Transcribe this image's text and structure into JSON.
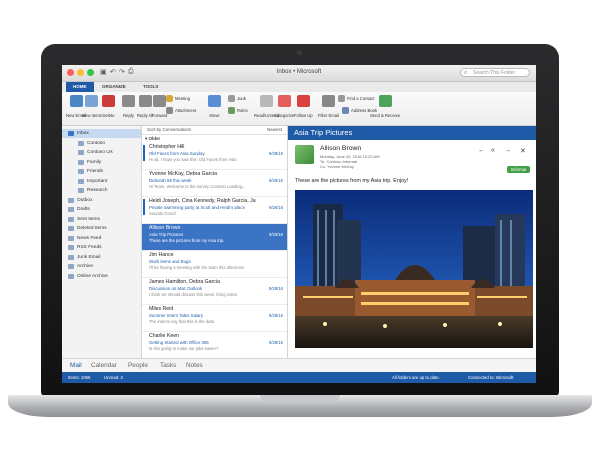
{
  "window": {
    "title": "Inbox • Microsoft",
    "search_placeholder": "Search This Folder"
  },
  "ribbon": {
    "tabs": [
      "HOME",
      "ORGANIZE",
      "TOOLS"
    ],
    "buttons": [
      {
        "label": "New Email",
        "icon": "new-email-icon",
        "color": "#4a86c7"
      },
      {
        "label": "New Items",
        "icon": "new-items-icon",
        "color": "#7aa4d6"
      },
      {
        "label": "Delete",
        "icon": "delete-icon",
        "color": "#cc3b3b"
      },
      {
        "label": "Reply",
        "icon": "reply-icon",
        "color": "#8a8a8a"
      },
      {
        "label": "Reply All",
        "icon": "reply-all-icon",
        "color": "#8a8a8a"
      },
      {
        "label": "Forward",
        "icon": "forward-icon",
        "color": "#8a8a8a"
      },
      {
        "label": "Meeting",
        "icon": "meeting-icon",
        "color": "#d9a73a"
      },
      {
        "label": "Attachment",
        "icon": "attachment-icon",
        "color": "#8a8a8a"
      },
      {
        "label": "Move",
        "icon": "move-icon",
        "color": "#5b8dd6"
      },
      {
        "label": "Junk",
        "icon": "junk-icon",
        "color": "#999999"
      },
      {
        "label": "Rules",
        "icon": "rules-icon",
        "color": "#6b9b5a"
      },
      {
        "label": "Read/Unread",
        "icon": "envelope-icon",
        "color": "#b8b8b8"
      },
      {
        "label": "Categorize",
        "icon": "categorize-icon",
        "color": "#e35d5d"
      },
      {
        "label": "Follow Up",
        "icon": "flag-icon",
        "color": "#d94040"
      },
      {
        "label": "Filter Email",
        "icon": "filter-icon",
        "color": "#888888"
      },
      {
        "label": "Find a Contact",
        "icon": "contact-icon",
        "color": "#999999"
      },
      {
        "label": "Address Book",
        "icon": "address-book-icon",
        "color": "#6a87b5"
      },
      {
        "label": "Send & Receive",
        "icon": "send-receive-icon",
        "color": "#4ca35a"
      }
    ]
  },
  "folders": [
    {
      "label": "Inbox",
      "selected": true
    },
    {
      "label": "Contoso"
    },
    {
      "label": "Contoso UX"
    },
    {
      "label": "Family"
    },
    {
      "label": "Friends"
    },
    {
      "label": "Important"
    },
    {
      "label": "Research"
    },
    {
      "label": "Outbox"
    },
    {
      "label": "Drafts"
    },
    {
      "label": "Sent Items"
    },
    {
      "label": "Deleted Items"
    },
    {
      "label": "News Feed"
    },
    {
      "label": "RSS Feeds"
    },
    {
      "label": "Junk Email"
    },
    {
      "label": "Archive"
    },
    {
      "label": "Online Archive"
    }
  ],
  "list": {
    "sort_label": "Sort by Conversations",
    "order_label": "Newest",
    "group_label": "Older",
    "messages": [
      {
        "from": "Christopher Hill",
        "subject": "Old Faces from Asia Sunday",
        "preview": "Hi all, I hope you saw this: Old Faces from Asia",
        "time": "9/28/16",
        "unread": true
      },
      {
        "from": "Yvonne McKay, Debra Garcia",
        "subject": "Deborah 55 this week",
        "preview": "Hi Team, Welcome to the survey Contoso Landing...",
        "time": "9/28/16",
        "unread": false
      },
      {
        "from": "Heidi Joseph, Cina Kennedy, Ralph Garcia, Ja",
        "subject": "Private swimming party at Scott and Heidi's place",
        "preview": "Sounds Good!",
        "time": "9/28/16",
        "unread": true
      },
      {
        "from": "Allison Brown",
        "subject": "Asia Trip Pictures",
        "preview": "These are the pictures from my Asia trip.",
        "time": "9/28/16",
        "selected": true
      },
      {
        "from": "Jim Hance",
        "subject": "Work items and Bugs",
        "preview": "I'll be having a meeting with the team this afternoon",
        "time": "",
        "unread": false
      },
      {
        "from": "James Hamilton, Debra Garcia",
        "subject": "Discussion on Mac Outlook",
        "preview": "I think we should discuss this week, bring notes.",
        "time": "9/28/16",
        "unread": false
      },
      {
        "from": "Miles Reid",
        "subject": "Summer Intern Tales Salary",
        "preview": "The interns say that this is the data",
        "time": "9/28/16",
        "unread": false
      },
      {
        "from": "Charlie Keen",
        "subject": "Getting Started with Office 365",
        "preview": "Is this going to make our jobs easier?",
        "time": "9/28/16",
        "unread": false
      }
    ]
  },
  "reading": {
    "title": "Asia Trip Pictures",
    "sender": "Allison Brown",
    "sent": "Monday, June 20, 2016 10:20 AM",
    "to": "To: Contoso Informal",
    "cc": "Cc: Yvonne McKay",
    "tag": "Informal",
    "body": "These are the pictures from my Asia trip.   Enjoy!"
  },
  "nav": [
    "Mail",
    "Calendar",
    "People",
    "Tasks",
    "Notes"
  ],
  "status": {
    "items": "Items: 1066",
    "unread": "Unread: 3",
    "sync": "All folders are up to date.",
    "connection": "Connected to: Microsoft"
  },
  "colors": {
    "accent": "#1e5aa8",
    "selection": "#3b73c5",
    "tag": "#43a047"
  }
}
